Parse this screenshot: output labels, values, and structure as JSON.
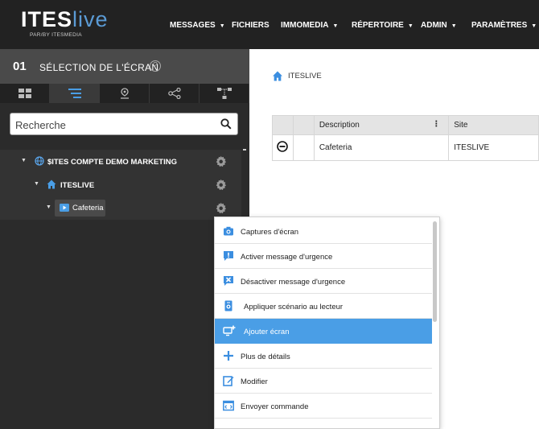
{
  "brand": {
    "logo_main": "ITES",
    "logo_accent": "live",
    "logo_sub": "PAR/BY ITESMEDIA"
  },
  "nav": [
    {
      "label": "MESSAGES",
      "has_caret": true
    },
    {
      "label": "FICHIERS",
      "has_caret": false
    },
    {
      "label": "IMMOMEDIA",
      "has_caret": true
    },
    {
      "label": "RÉPERTOIRE",
      "has_caret": true
    },
    {
      "label": "ADMIN",
      "has_caret": true
    },
    {
      "label": "PARAMÈTRES",
      "has_caret": true
    }
  ],
  "sidebar": {
    "step": "01",
    "title": "SÉLECTION DE L'ÉCRAN",
    "help": "?",
    "tabs": [
      "grid-icon",
      "filter-list-icon",
      "location-icon",
      "share-icon",
      "hierarchy-icon"
    ],
    "search_placeholder": "Recherche",
    "tree": [
      {
        "label": "$ITES COMPTE DEMO MARKETING",
        "icon": "globe-icon"
      },
      {
        "label": "ITESLIVE",
        "icon": "home-icon"
      },
      {
        "label": "Cafeteria",
        "icon": "screen-play-icon"
      }
    ]
  },
  "main": {
    "breadcrumb": "ITESLIVE",
    "table": {
      "columns": [
        "",
        "",
        "Description",
        "Site"
      ],
      "rows": [
        {
          "description": "Cafeteria",
          "site": "ITESLIVE"
        }
      ]
    }
  },
  "context_menu": {
    "items": [
      {
        "label": "Captures d'écran",
        "icon": "camera-icon"
      },
      {
        "label": "Activer message d'urgence",
        "icon": "alert-message-icon"
      },
      {
        "label": "Désactiver message d'urgence",
        "icon": "close-message-icon"
      },
      {
        "label": "Appliquer scénario au lecteur",
        "icon": "apply-scenario-icon"
      },
      {
        "label": "Ajouter écran",
        "icon": "add-screen-icon"
      },
      {
        "label": "Plus de détails",
        "icon": "plus-icon"
      },
      {
        "label": "Modifier",
        "icon": "edit-icon"
      },
      {
        "label": "Envoyer commande",
        "icon": "command-icon"
      }
    ],
    "active_index": 4
  },
  "colors": {
    "topbar": "#222222",
    "sidebar": "#2b2b2b",
    "accent": "#4a9ee6",
    "icon_blue": "#3b8ee0"
  }
}
